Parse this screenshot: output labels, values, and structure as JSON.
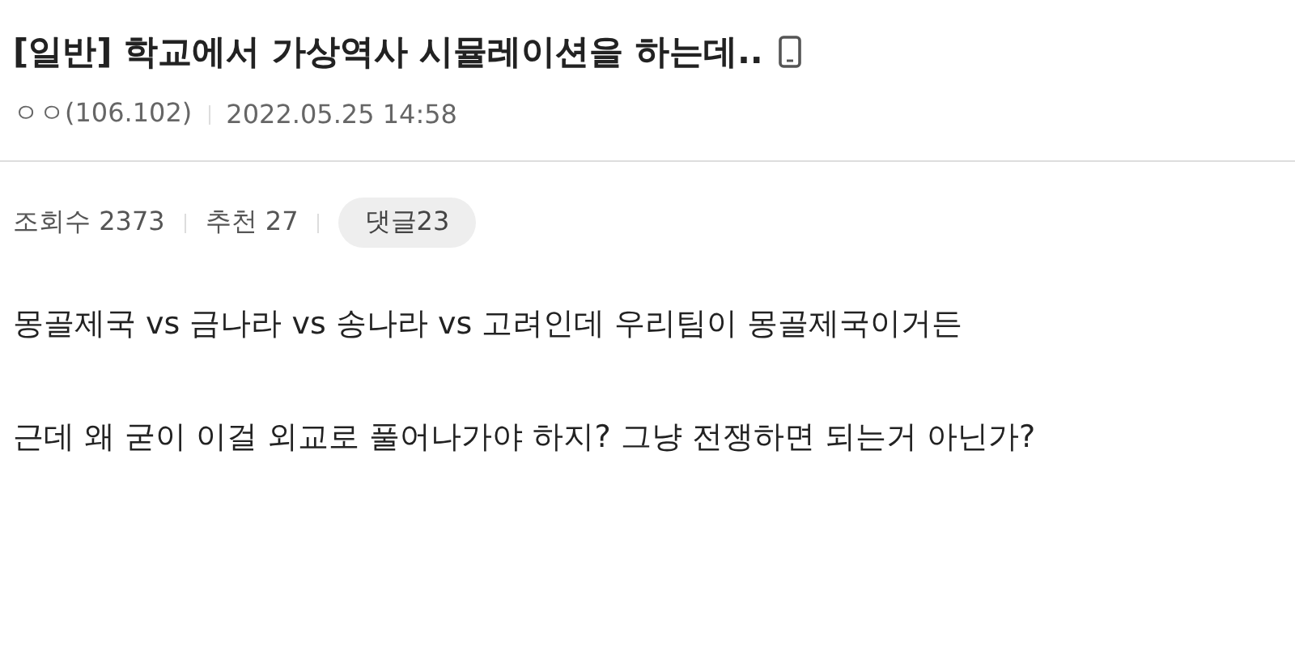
{
  "post": {
    "category": "[일반]",
    "title": "학교에서 가상역사 시뮬레이션을 하는데..",
    "author": "ㅇㅇ(106.102)",
    "date": "2022.05.25 14:58"
  },
  "stats": {
    "views_label": "조회수",
    "views": "2373",
    "likes_label": "추천",
    "likes": "27",
    "comments": "댓글23"
  },
  "body": [
    "몽골제국 vs 금나라 vs 송나라 vs 고려인데 우리팀이 몽골제국이거든",
    "근데 왜 굳이 이걸 외교로 풀어나가야 하지? 그냥 전쟁하면 되는거 아닌가?"
  ]
}
